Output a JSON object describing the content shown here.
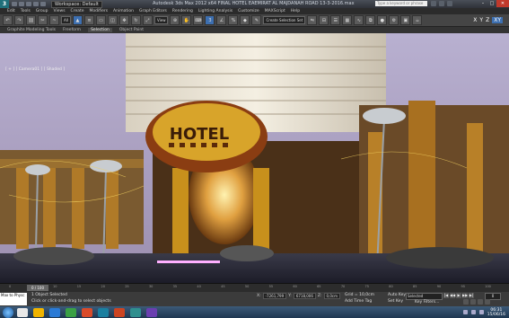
{
  "titlebar": {
    "workspace": "Workspace: Default",
    "title": "Autodesk 3ds Max 2012 x64   FINAL  HOTEL EAEMIRAT   AL MAJDANAH ROAD   13-3-2016.max",
    "search_placeholder": "Type a keyword or phrase",
    "window_min": "–",
    "window_max": "□",
    "window_close": "✕"
  },
  "menu": [
    "Edit",
    "Tools",
    "Group",
    "Views",
    "Create",
    "Modifiers",
    "Animation",
    "Graph Editors",
    "Rendering",
    "Lighting Analysis",
    "Customize",
    "MAXScript",
    "Help"
  ],
  "toolbar": {
    "selection_filter": "All",
    "reference_coord": "View",
    "named_selection": "Create Selection Set",
    "axes": [
      "X",
      "Y",
      "Z",
      "XY"
    ]
  },
  "ribbon": {
    "tabs": [
      "Graphite Modeling Tools",
      "Freeform",
      "Selection",
      "Object Paint"
    ],
    "active": "Selection"
  },
  "viewport": {
    "label": "[ + ] [ Camera01 ] [ Shaded ]",
    "sign_text": "HOTEL"
  },
  "timeline": {
    "slider": "0 / 100",
    "ticks": [
      "0",
      "5",
      "10",
      "15",
      "20",
      "25",
      "30",
      "35",
      "40",
      "45",
      "50",
      "55",
      "60",
      "65",
      "70",
      "75",
      "80",
      "85",
      "90",
      "95",
      "100"
    ]
  },
  "status": {
    "minilistener_text": "Max to Physc",
    "objects_selected": "1 Object Selected",
    "prompt": "Click or click-and-drag to select objects",
    "x_label": "X:",
    "x_val": "-7261,799",
    "y_label": "Y:",
    "y_val": "6718,006",
    "z_label": "Z:",
    "z_val": "0,0cm",
    "grid": "Grid = 10,0cm",
    "add_time_tag": "Add Time Tag",
    "auto_key": "Auto Key",
    "set_key": "Set Key",
    "selected_dropdown": "Selected",
    "key_filters": "Key Filters...",
    "frame": "0",
    "play_buttons": [
      "|◀",
      "◀◀",
      "▶",
      "▶▶",
      "▶|"
    ]
  },
  "taskbar": {
    "time": "06:31",
    "date": "15/06/16",
    "app_colors": [
      "#e8e8e8",
      "#f0b400",
      "#2a7ad6",
      "#3aa045",
      "#d84b2a",
      "#1a7fa0",
      "#c42",
      "#2f8f8f",
      "#6a3fb0"
    ]
  }
}
